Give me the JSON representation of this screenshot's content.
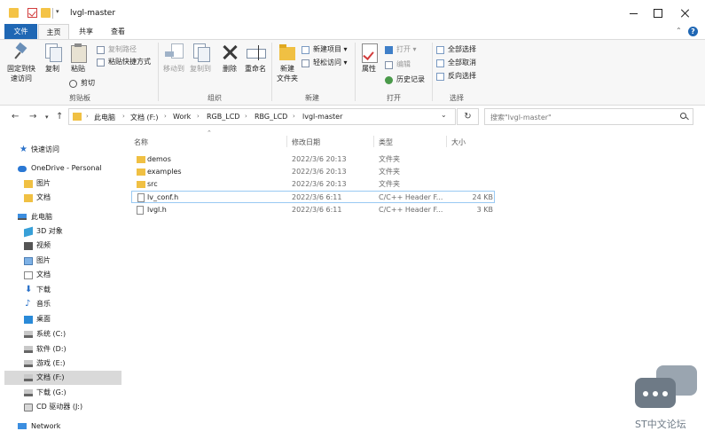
{
  "window": {
    "title": "lvgl-master"
  },
  "tabs": {
    "file": "文件",
    "home": "主页",
    "share": "共享",
    "view": "查看",
    "help": "?"
  },
  "ribbon": {
    "clipboard": {
      "pin_quick_access": "固定到快\n速访问",
      "copy": "复制",
      "paste": "粘贴",
      "copy_path": "复制路径",
      "paste_shortcut": "粘贴快捷方式",
      "cut": "剪切",
      "group_label": "剪贴板"
    },
    "organize": {
      "move_to": "移动到",
      "copy_to": "复制到",
      "delete": "删除",
      "rename": "重命名",
      "group_label": "组织"
    },
    "new": {
      "new_folder": "新建\n文件夹",
      "new_item": "新建项目",
      "easy_access": "轻松访问",
      "group_label": "新建"
    },
    "open": {
      "properties": "属性",
      "open": "打开",
      "edit": "编辑",
      "history": "历史记录",
      "group_label": "打开"
    },
    "select": {
      "select_all": "全部选择",
      "select_none": "全部取消",
      "invert_selection": "反向选择",
      "group_label": "选择"
    }
  },
  "address": {
    "crumbs": [
      "此电脑",
      "文档 (F:)",
      "Work",
      "RGB_LCD",
      "RBG_LCD",
      "lvgl-master"
    ],
    "search_placeholder": "搜索\"lvgl-master\""
  },
  "nav": {
    "quick_access": "快速访问",
    "onedrive": "OneDrive - Personal",
    "od_pictures": "图片",
    "od_documents": "文档",
    "this_pc": "此电脑",
    "objects_3d": "3D 对象",
    "videos": "视频",
    "pictures": "图片",
    "documents": "文档",
    "downloads": "下载",
    "music": "音乐",
    "desktop": "桌面",
    "drive_c": "系统 (C:)",
    "drive_d": "软件 (D:)",
    "drive_e": "游戏 (E:)",
    "drive_f": "文档 (F:)",
    "drive_g": "下载 (G:)",
    "drive_j": "CD 驱动器 (J:)",
    "network": "Network"
  },
  "columns": {
    "name": "名称",
    "modified": "修改日期",
    "type": "类型",
    "size": "大小"
  },
  "files": [
    {
      "name": "demos",
      "modified": "2022/3/6 20:13",
      "type": "文件夹",
      "size": "",
      "kind": "folder"
    },
    {
      "name": "examples",
      "modified": "2022/3/6 20:13",
      "type": "文件夹",
      "size": "",
      "kind": "folder"
    },
    {
      "name": "src",
      "modified": "2022/3/6 20:13",
      "type": "文件夹",
      "size": "",
      "kind": "folder"
    },
    {
      "name": "lv_conf.h",
      "modified": "2022/3/6 6:11",
      "type": "C/C++ Header F...",
      "size": "24 KB",
      "kind": "file"
    },
    {
      "name": "lvgl.h",
      "modified": "2022/3/6 6:11",
      "type": "C/C++ Header F...",
      "size": "3 KB",
      "kind": "file"
    }
  ],
  "watermark": {
    "text": "ST中文论坛"
  },
  "colors": {
    "accent": "#1f67b4",
    "folder": "#f0c043",
    "selection": "#d9d9d9"
  }
}
